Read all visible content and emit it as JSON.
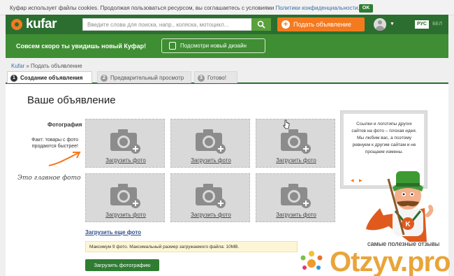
{
  "cookie": {
    "text": "Куфар использует файлы cookies. Продолжая пользоваться ресурсом, вы соглашаетесь с условиями",
    "link": "Политики конфиденциальности.",
    "ok": "OK"
  },
  "header": {
    "brand": "kufar",
    "search_placeholder": "Введите слова для поиска, напр., коляска, мотоцикл...",
    "post_button": "Подать объявление",
    "lang_active": "РУС",
    "lang_other": "БЕЛ"
  },
  "banner": {
    "message": "Совсем скоро ты увидишь новый Куфар!",
    "button": "Подсмотри новый дизайн"
  },
  "breadcrumb": {
    "home": "Kufar",
    "separator": "»",
    "current": "Подать объявление"
  },
  "steps": [
    {
      "number": "1",
      "label": "Создание объявления"
    },
    {
      "number": "2",
      "label": "Предварительный просмотр"
    },
    {
      "number": "3",
      "label": "Готово!"
    }
  ],
  "main": {
    "title": "Ваше объявление",
    "photos_label": "Фотография",
    "fact": "Факт: товары с фото продаются быстрее!",
    "handwritten": "Это главное фото",
    "slot_label": "Загрузить фото",
    "more_link": "Загрузить еще фото",
    "limit_note": "Максимум 9 фото. Максимальный размер загружаемого файла: 10MB.",
    "upload_button": "Загрузить фотографию"
  },
  "tip": {
    "text": "Ссылки и логотипы других сайтов на фото – плохая идея. Мы любим вас, а поэтому ревнуем к другим сайтам и не прощаем измены.",
    "prev": "◀",
    "next": "▶"
  },
  "watermark": {
    "text": "самые полезные отзывы",
    "name": "Otzyv.pro"
  },
  "colors": {
    "brand_green": "#2c6e2f",
    "banner_green": "#3f8e33",
    "accent_orange": "#f47a1f"
  }
}
